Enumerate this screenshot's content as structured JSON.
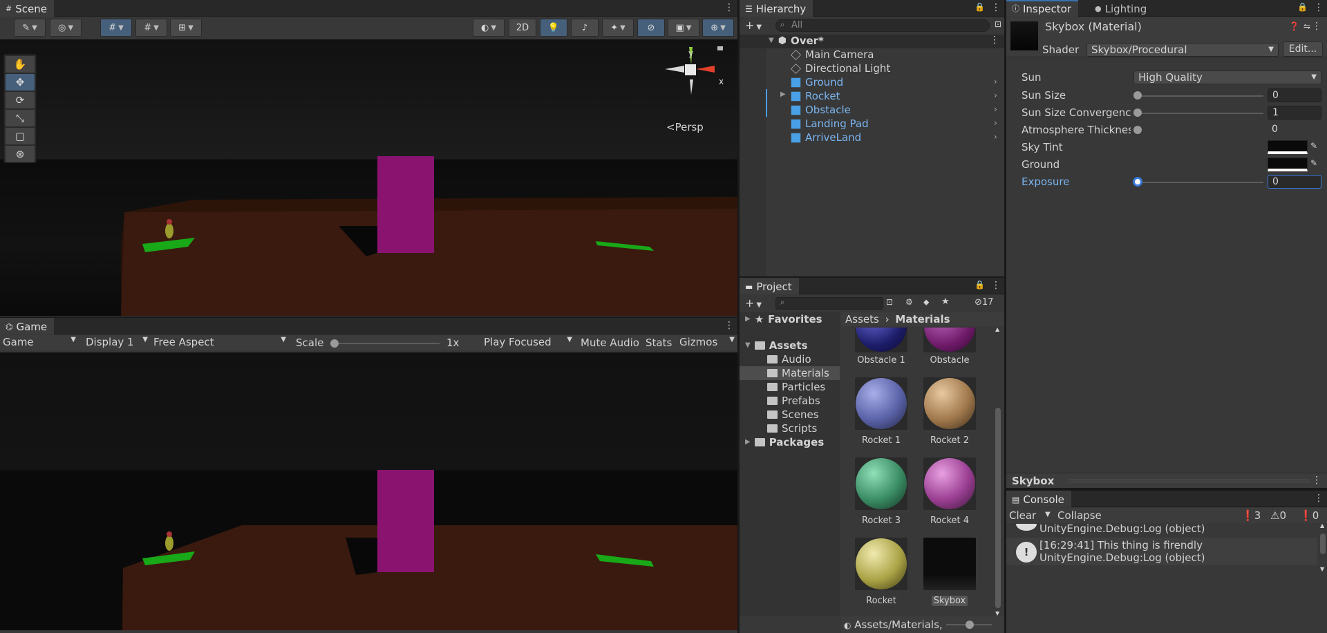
{
  "scene": {
    "tab": "Scene",
    "persp": "Persp",
    "mode2d": "2D",
    "axis_y": "y",
    "axis_x": "x"
  },
  "game": {
    "tab": "Game",
    "view": "Game",
    "display": "Display 1",
    "aspect": "Free Aspect",
    "scale_label": "Scale",
    "scale_value": "1x",
    "play_mode": "Play Focused",
    "mute": "Mute Audio",
    "stats": "Stats",
    "gizmos": "Gizmos"
  },
  "hierarchy": {
    "tab": "Hierarchy",
    "search_placeholder": "All",
    "root": "Over*",
    "items": [
      "Main Camera",
      "Directional Light",
      "Ground",
      "Rocket",
      "Obstacle",
      "Landing Pad",
      "ArriveLand"
    ]
  },
  "inspector": {
    "tab": "Inspector",
    "tab2": "Lighting",
    "title": "Skybox (Material)",
    "shader_label": "Shader",
    "shader_value": "Skybox/Procedural",
    "edit_button": "Edit...",
    "props": {
      "sun_label": "Sun",
      "sun_value": "High Quality",
      "sun_size_label": "Sun Size",
      "sun_size_value": "0",
      "convergence_label": "Sun Size Convergenc",
      "convergence_value": "1",
      "atmosphere_label": "Atmosphere Thicknes",
      "atmosphere_value": "0",
      "sky_tint_label": "Sky Tint",
      "ground_label": "Ground",
      "exposure_label": "Exposure",
      "exposure_value": "0"
    },
    "preview_label": "Skybox"
  },
  "project": {
    "tab": "Project",
    "hidden_count": "17",
    "favorites": "Favorites",
    "assets": "Assets",
    "folders": [
      "Audio",
      "Materials",
      "Particles",
      "Prefabs",
      "Scenes",
      "Scripts"
    ],
    "packages": "Packages",
    "breadcrumb_root": "Assets",
    "breadcrumb_current": "Materials",
    "footer_path": "Assets/Materials,",
    "materials": [
      "Obstacle 1",
      "Obstacle",
      "Rocket 1",
      "Rocket 2",
      "Rocket 3",
      "Rocket 4",
      "Rocket",
      "Skybox"
    ],
    "colors": {
      "rocket1": "#6b74b8",
      "rocket2": "#b58a5c",
      "rocket3": "#3f9a6f",
      "rocket4": "#a9479f",
      "rocket": "#bdb44e"
    }
  },
  "console": {
    "tab": "Console",
    "clear": "Clear",
    "collapse": "Collapse",
    "errors": "3",
    "warnings": "0",
    "logs": "0",
    "line_top": "UnityEngine.Debug:Log (object)",
    "entry_line1": "[16:29:41] This thing is firendly",
    "entry_line2": "UnityEngine.Debug:Log (object)"
  }
}
